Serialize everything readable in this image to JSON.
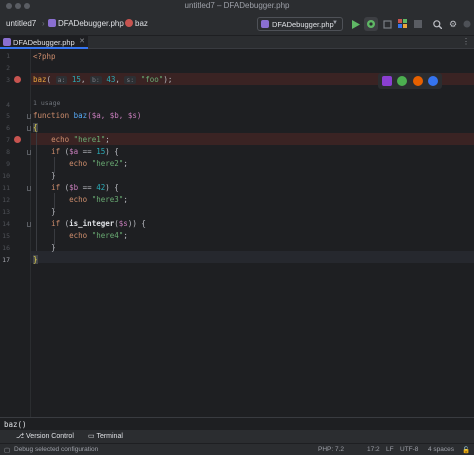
{
  "window": {
    "title": "untitled7 – DFADebugger.php"
  },
  "navbar": {
    "project": "untitled7",
    "file": "DFADebugger.php",
    "function": "baz",
    "run_config": "DFADebugger.php"
  },
  "tabs": [
    {
      "label": "DFADebugger.php"
    }
  ],
  "editor": {
    "usage_hint": "1 usage",
    "line_numbers": [
      "1",
      "2",
      "3",
      "4",
      "5",
      "6",
      "7",
      "8",
      "9",
      "10",
      "11",
      "12",
      "13",
      "14",
      "15",
      "16",
      "17"
    ],
    "code": {
      "l1_open": "<?php",
      "l3_fn": "baz",
      "l3_open": "(",
      "l3_hint_a": "a:",
      "l3_a": "15",
      "l3_hint_b": "b:",
      "l3_b": "43",
      "l3_hint_s": "s:",
      "l3_s": "\"foo\"",
      "l3_close": ");",
      "l5_kw": "function",
      "l5_name": "baz",
      "l5_params": "($a, $b, $s)",
      "l6": "{",
      "l7_kw": "echo",
      "l7_str": "\"here1\"",
      "l8_kw": "if",
      "l8_open": " (",
      "l8_var": "$a",
      "l8_op": " == ",
      "l8_num": "15",
      "l8_close": ") {",
      "l9_kw": "echo",
      "l9_str": "\"here2\"",
      "l10": "}",
      "l11_kw": "if",
      "l11_open": " (",
      "l11_var": "$b",
      "l11_op": " == ",
      "l11_num": "42",
      "l11_close": ") {",
      "l12_kw": "echo",
      "l12_str": "\"here3\"",
      "l13": "}",
      "l14_kw": "if",
      "l14_open": " (",
      "l14_fn": "is_integer",
      "l14_paren": "(",
      "l14_var": "$s",
      "l14_close": ")) {",
      "l15_kw": "echo",
      "l15_str": "\"here4\"",
      "l16": "}",
      "l17": "}",
      "semicolon": ";"
    }
  },
  "breadcrumb_bottom": "baz()",
  "tool_windows": {
    "version_control": "Version Control",
    "terminal": "Terminal"
  },
  "status": {
    "message": "Debug selected configuration",
    "php": "PHP: 7.2",
    "position": "17:2",
    "line_sep": "LF",
    "encoding": "UTF-8",
    "indent": "4 spaces"
  },
  "icons": {
    "run": "play-icon",
    "debug": "debug-bug-icon",
    "coverage": "coverage-icon",
    "profile": "profile-icon",
    "stop": "stop-icon",
    "search": "search-icon",
    "settings": "gear-icon"
  },
  "colors": {
    "accent": "#3574f0",
    "breakpoint": "#c75450",
    "run": "#5fb865"
  }
}
